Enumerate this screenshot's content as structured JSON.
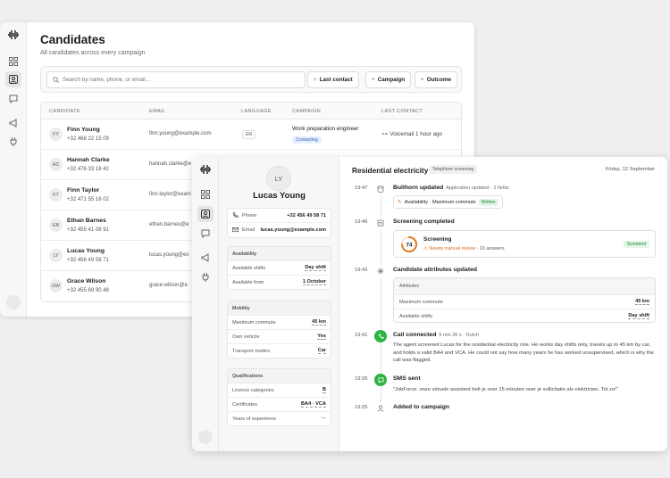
{
  "candidates_page": {
    "title": "Candidates",
    "subtitle": "All candidates across every campaign",
    "search_placeholder": "Search by name, phone, or email...",
    "filters": [
      "Last contact",
      "Campaign",
      "Outcome"
    ],
    "columns": [
      "CANDIDATE",
      "EMAIL",
      "LANGUAGE",
      "CAMPAIGN",
      "LAST CONTACT"
    ],
    "rows": [
      {
        "initials": "FY",
        "name": "Finn Young",
        "phone": "+32 468 22 15 09",
        "email": "finn.young@example.com",
        "language": "EN",
        "campaign": "Work preparation engineer",
        "status": "Contacting",
        "last_contact": "Voicemail 1 hour ago"
      },
      {
        "initials": "HC",
        "name": "Hannah Clarke",
        "phone": "+32 476 33 18 42",
        "email": "hannah.clarke@e"
      },
      {
        "initials": "FT",
        "name": "Finn Taylor",
        "phone": "+32 471 55 16 02",
        "email": "finn.taylor@exam"
      },
      {
        "initials": "EB",
        "name": "Ethan Barnes",
        "phone": "+32 455 41 08 91",
        "email": "ethan.barnes@e"
      },
      {
        "initials": "LY",
        "name": "Lucas Young",
        "phone": "+32 456 49 58 71",
        "email": "lucas.young@ex"
      },
      {
        "initials": "GW",
        "name": "Grace Wilson",
        "phone": "+32 455 69 90 48",
        "email": "grace.wilson@e"
      }
    ]
  },
  "detail": {
    "initials": "LY",
    "name": "Lucas Young",
    "contact": {
      "phone_label": "Phone",
      "phone": "+32 456 49 58 71",
      "email_label": "Email",
      "email": "lucas.young@example.com"
    },
    "sections": [
      {
        "title": "Availability",
        "rows": [
          [
            "Available shifts",
            "Day shift"
          ],
          [
            "Available from",
            "1 October"
          ]
        ]
      },
      {
        "title": "Mobility",
        "rows": [
          [
            "Maximum commute",
            "45 km"
          ],
          [
            "Own vehicle",
            "Yes"
          ],
          [
            "Transport modes",
            "Car"
          ]
        ]
      },
      {
        "title": "Qualifications",
        "rows": [
          [
            "Licence categories",
            "B"
          ],
          [
            "Certificates",
            "BA4 · VCA"
          ],
          [
            "Years of experience",
            "—"
          ]
        ]
      }
    ],
    "campaign_title": "Residential electricity",
    "campaign_tag": "Telephone screening",
    "date": "Friday, 12 September",
    "timeline": [
      {
        "time": "19:47",
        "title": "Bullhorn updated",
        "meta": "Application updated · 2 fields",
        "chip_text": "Availability · Maximum commute",
        "chip_badge": "Written"
      },
      {
        "time": "19:46",
        "title": "Screening completed",
        "score": "74",
        "score_pct": 74,
        "card_title": "Screening",
        "warning": "Needs manual review",
        "answers": "· 10 answers",
        "badge": "Screened"
      },
      {
        "time": "19:42",
        "title": "Candidate attributes updated",
        "attr_header": "Attributes",
        "attrs": [
          [
            "Maximum commute",
            "45 km"
          ],
          [
            "Available shifts",
            "Day shift"
          ]
        ]
      },
      {
        "time": "19:41",
        "title": "Call connected",
        "meta": "5 min 36 s · Dutch",
        "text": "The agent screened Lucas for the residential electricity role. He works day shifts only, travels up to 45 km by car, and holds a valid BA4 and VCA. He could not say how many years he has worked unsupervised, which is why the call was flagged."
      },
      {
        "time": "19:26",
        "title": "SMS sent",
        "text": "\"JobForce: onze virtuele assistent belt je over 15 minuten over je sollicitatie als elektricien. Tot zo!\""
      },
      {
        "time": "19:25",
        "title": "Added to campaign"
      }
    ]
  },
  "colors": {
    "accent_green": "#2fb344",
    "warning_orange": "#d76a1b",
    "pill_blue": "#2f5fbf"
  }
}
